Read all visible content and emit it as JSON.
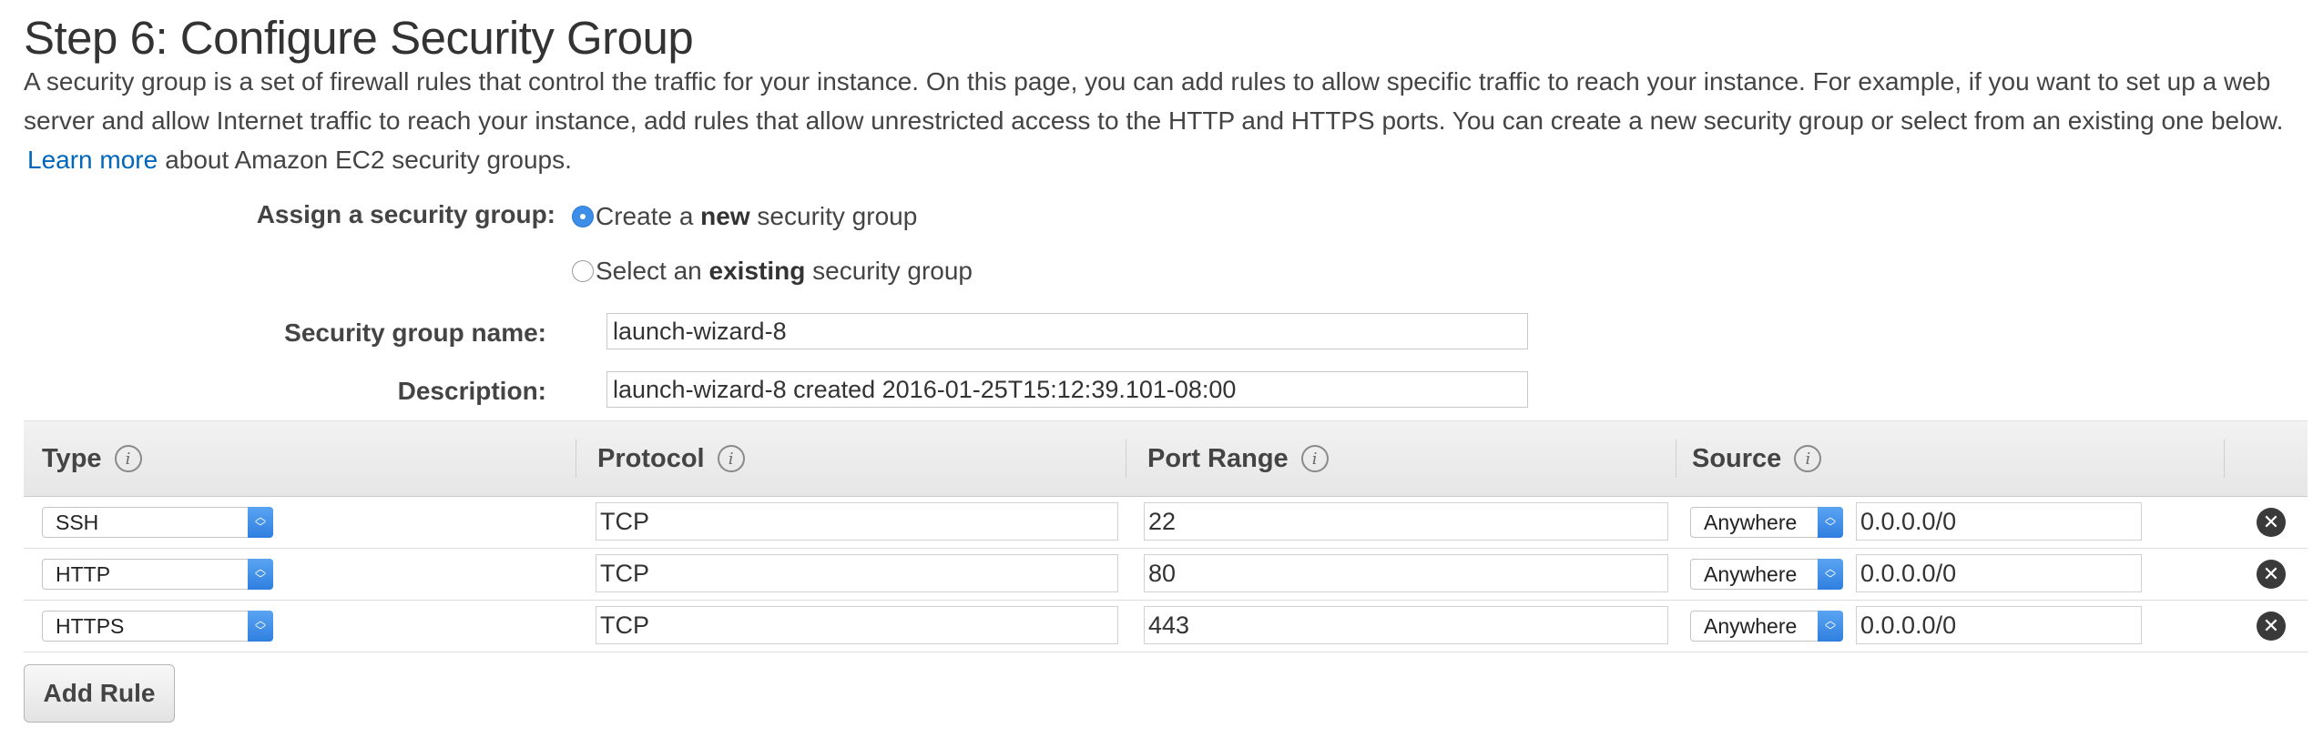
{
  "page": {
    "title": "Step 6: Configure Security Group",
    "intro_text": "A security group is a set of firewall rules that control the traffic for your instance. On this page, you can add rules to allow specific traffic to reach your instance. For example, if you want to set up a web server and allow Internet traffic to reach your instance, add rules that allow unrestricted access to the HTTP and HTTPS ports. You can create a new security group or select from an existing one below.",
    "learn_more_link": "Learn more",
    "intro_suffix": "about Amazon EC2 security groups."
  },
  "assign": {
    "label": "Assign a security group:",
    "option_new": {
      "prefix": "Create a ",
      "bold": "new",
      "suffix": " security group",
      "selected": true
    },
    "option_existing": {
      "prefix": "Select an ",
      "bold": "existing",
      "suffix": " security group",
      "selected": false
    }
  },
  "group_name": {
    "label": "Security group name:",
    "value": "launch-wizard-8"
  },
  "description": {
    "label": "Description:",
    "value": "launch-wizard-8 created 2016-01-25T15:12:39.101-08:00"
  },
  "table": {
    "headers": {
      "type": "Type",
      "protocol": "Protocol",
      "port_range": "Port Range",
      "source": "Source"
    },
    "info_glyph": "i",
    "remove_glyph": "✕",
    "rows": [
      {
        "type": "SSH",
        "protocol": "TCP",
        "port": "22",
        "source_type": "Anywhere",
        "source_cidr": "0.0.0.0/0"
      },
      {
        "type": "HTTP",
        "protocol": "TCP",
        "port": "80",
        "source_type": "Anywhere",
        "source_cidr": "0.0.0.0/0"
      },
      {
        "type": "HTTPS",
        "protocol": "TCP",
        "port": "443",
        "source_type": "Anywhere",
        "source_cidr": "0.0.0.0/0"
      }
    ]
  },
  "add_rule_label": "Add Rule",
  "colors": {
    "link": "#0066bb",
    "radio_selected": "#3d8ee6",
    "select_arrow": "#2f7fe0"
  }
}
